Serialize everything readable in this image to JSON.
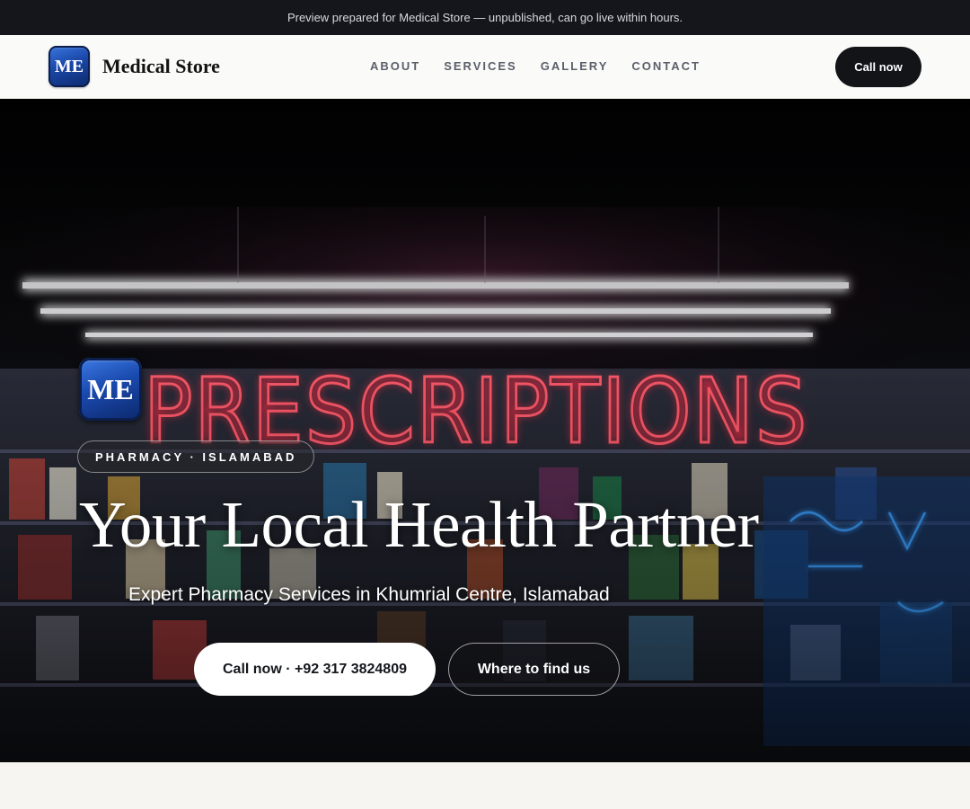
{
  "preview_banner": {
    "text": "Preview prepared for Medical Store — unpublished, can go live within hours."
  },
  "nav": {
    "logo_text": "ME",
    "brand_name": "Medical Store",
    "links": [
      {
        "label": "ABOUT"
      },
      {
        "label": "SERVICES"
      },
      {
        "label": "GALLERY"
      },
      {
        "label": "CONTACT"
      }
    ],
    "call_button": "Call now"
  },
  "hero": {
    "logo_text": "ME",
    "tag": "PHARMACY · ISLAMABAD",
    "title": "Your Local Health Partner",
    "subtitle": "Expert Pharmacy Services in Khumrial Centre, Islamabad",
    "primary_button": "Call now · +92 317 3824809",
    "secondary_button": "Where to find us",
    "background_image": "pharmacy storefront with red neon PRESCRIPTIONS sign"
  },
  "colors": {
    "dark": "#14161b",
    "brand_blue": "#1a47a8",
    "neon_red": "#d8283c",
    "neon_blue": "#2f8fe8"
  }
}
